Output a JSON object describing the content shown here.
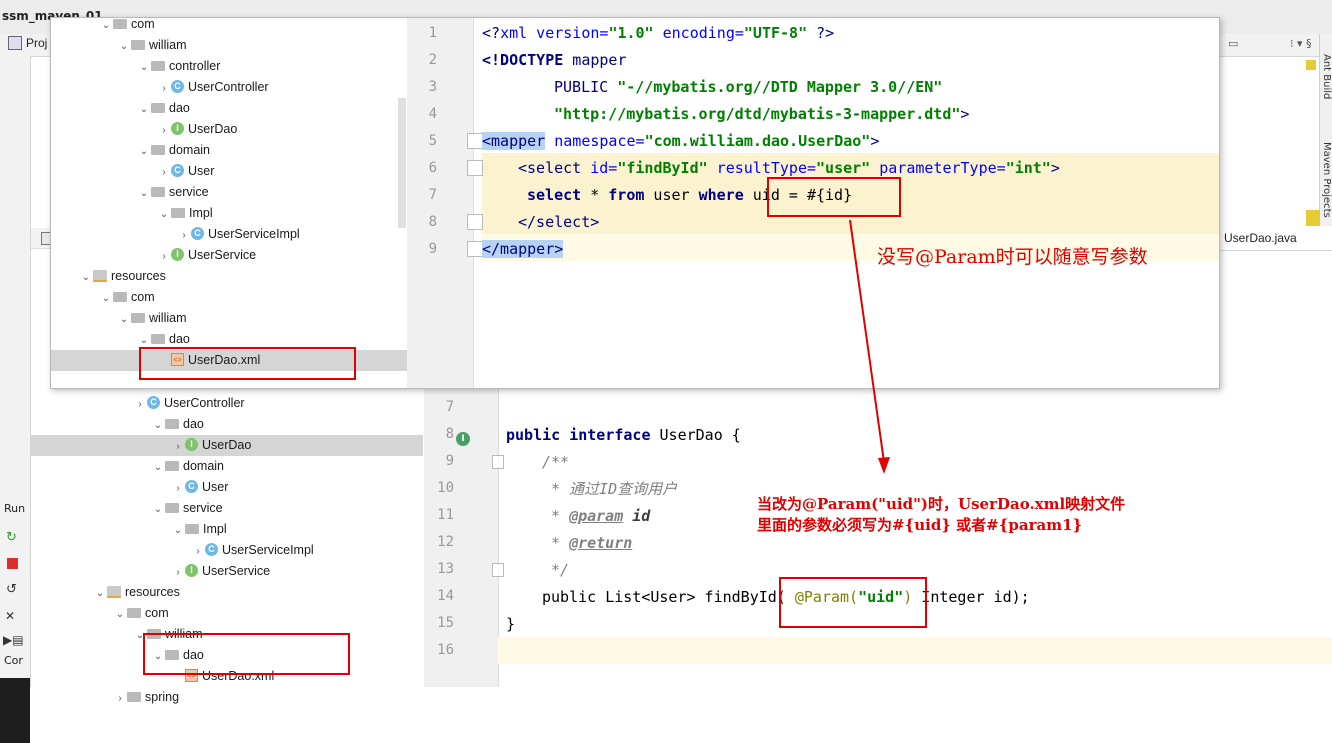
{
  "ide": {
    "project_name": "ssm_maven_01",
    "project_tab": "Proj",
    "run_label": "Run",
    "console_label": "Cor",
    "right_tool_ant": "Ant Build",
    "right_tool_maven": "Maven Projects",
    "editor_tab": "UserDao.java"
  },
  "tree_bg": {
    "rows": [
      {
        "label": "spring",
        "type": "folder"
      },
      {
        "label": "UserController",
        "type": "class"
      },
      {
        "label": "dao",
        "type": "folder"
      },
      {
        "label": "UserDao",
        "type": "interface"
      },
      {
        "label": "domain",
        "type": "folder"
      },
      {
        "label": "User",
        "type": "class"
      },
      {
        "label": "service",
        "type": "folder"
      },
      {
        "label": "Impl",
        "type": "folder"
      },
      {
        "label": "UserServiceImpl",
        "type": "class"
      },
      {
        "label": "UserService",
        "type": "interface"
      },
      {
        "label": "resources",
        "type": "resfolder"
      },
      {
        "label": "com",
        "type": "folder"
      },
      {
        "label": "william",
        "type": "folder"
      },
      {
        "label": "dao",
        "type": "folder"
      },
      {
        "label": "UserDao.xml",
        "type": "xml"
      },
      {
        "label": "spring",
        "type": "folder"
      }
    ]
  },
  "java_editor": {
    "line_numbers": [
      "7",
      "8",
      "9",
      "10",
      "11",
      "12",
      "13",
      "14",
      "15",
      "16"
    ],
    "public_kw": "public",
    "interface_kw": "interface",
    "class_name": "UserDao",
    "brace_open": "{",
    "doc_open": "/**",
    "doc_desc": "* 通过ID查询用户",
    "doc_star": "*",
    "doc_param_tag": "@param",
    "doc_param_name": "id",
    "doc_return_tag": "@return",
    "doc_close": "*/",
    "method_pre": "public List<User> findById(",
    "annotation": "@Param(",
    "annotation_value": "\"uid\"",
    "annotation_close": ")",
    "method_post": " Integer id);",
    "brace_close": "}"
  },
  "popup_tree": {
    "rows": [
      {
        "label": "com",
        "type": "folder"
      },
      {
        "label": "william",
        "type": "folder"
      },
      {
        "label": "controller",
        "type": "folder"
      },
      {
        "label": "UserController",
        "type": "class"
      },
      {
        "label": "dao",
        "type": "folder"
      },
      {
        "label": "UserDao",
        "type": "interface"
      },
      {
        "label": "domain",
        "type": "folder"
      },
      {
        "label": "User",
        "type": "class"
      },
      {
        "label": "service",
        "type": "folder"
      },
      {
        "label": "Impl",
        "type": "folder"
      },
      {
        "label": "UserServiceImpl",
        "type": "class"
      },
      {
        "label": "UserService",
        "type": "interface"
      },
      {
        "label": "resources",
        "type": "resfolder"
      },
      {
        "label": "com",
        "type": "folder"
      },
      {
        "label": "william",
        "type": "folder"
      },
      {
        "label": "dao",
        "type": "folder"
      },
      {
        "label": "UserDao.xml",
        "type": "xml"
      }
    ]
  },
  "xml_editor": {
    "line_numbers": [
      "1",
      "2",
      "3",
      "4",
      "5",
      "6",
      "7",
      "8",
      "9"
    ],
    "l1_decl_open": "<?",
    "l1_xml": "xml",
    "l1_version_attr": " version=",
    "l1_version_val": "\"1.0\"",
    "l1_enc_attr": " encoding=",
    "l1_enc_val": "\"UTF-8\"",
    "l1_decl_close": " ?>",
    "l2_doctype": "<!DOCTYPE",
    "l2_mapper": " mapper",
    "l3_public": "PUBLIC",
    "l3_pubid": " \"-//mybatis.org//DTD Mapper 3.0//EN\"",
    "l4_sysid": "\"http://mybatis.org/dtd/mybatis-3-mapper.dtd\"",
    "l4_close": ">",
    "l5_open": "<mapper",
    "l5_ns_attr": " namespace=",
    "l5_ns_val": "\"com.william.dao.UserDao\"",
    "l5_close": ">",
    "l6_open": "<select",
    "l6_id_attr": " id=",
    "l6_id_val": "\"findById\"",
    "l6_rt_attr": " resultType=",
    "l6_rt_val": "\"user\"",
    "l6_pt_attr": " parameterType=",
    "l6_pt_val": "\"int\"",
    "l6_close": ">",
    "l7_sql_select": "select",
    "l7_sql_star": " * ",
    "l7_sql_from": "from",
    "l7_sql_user": " user ",
    "l7_sql_where": "where",
    "l7_sql_cond": " uid = #{id}",
    "l8_close": "</select>",
    "l9_close": "</mapper>"
  },
  "annotations": {
    "note_top": "没写@Param时可以随意写参数",
    "note_bottom_line1": "当改为@Param(\"uid\")时，UserDao.xml映射文件",
    "note_bottom_line2": "里面的参数必须写为#{uid} 或者#{param1}",
    "accent_color": "#e00000"
  }
}
